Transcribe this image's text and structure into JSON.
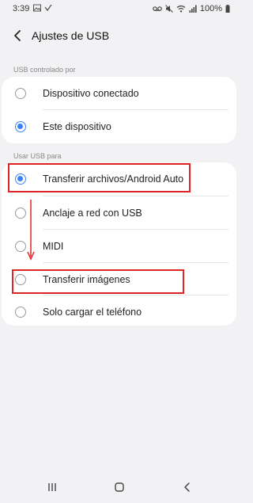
{
  "status_bar": {
    "time": "3:39",
    "battery": "100%",
    "left_icons": [
      "image-icon",
      "check-icon"
    ],
    "right_icons": [
      "voicemail-icon",
      "mute-icon",
      "wifi-icon",
      "signal-icon",
      "battery-icon"
    ]
  },
  "header": {
    "title": "Ajustes de USB"
  },
  "section_controlled": {
    "label": "USB controlado por",
    "options": [
      {
        "label": "Dispositivo conectado",
        "selected": false
      },
      {
        "label": "Este dispositivo",
        "selected": true
      }
    ]
  },
  "section_use": {
    "label": "Usar USB para",
    "options": [
      {
        "label": "Transferir archivos/Android Auto",
        "selected": true
      },
      {
        "label": "Anclaje a red con USB",
        "selected": false
      },
      {
        "label": "MIDI",
        "selected": false
      },
      {
        "label": "Transferir imágenes",
        "selected": false
      },
      {
        "label": "Solo cargar el teléfono",
        "selected": false
      }
    ]
  },
  "annotation_color": "#e02424",
  "accent_color": "#3b82f6",
  "nav": {
    "icons": [
      "recent-apps-icon",
      "home-icon",
      "back-icon"
    ]
  }
}
